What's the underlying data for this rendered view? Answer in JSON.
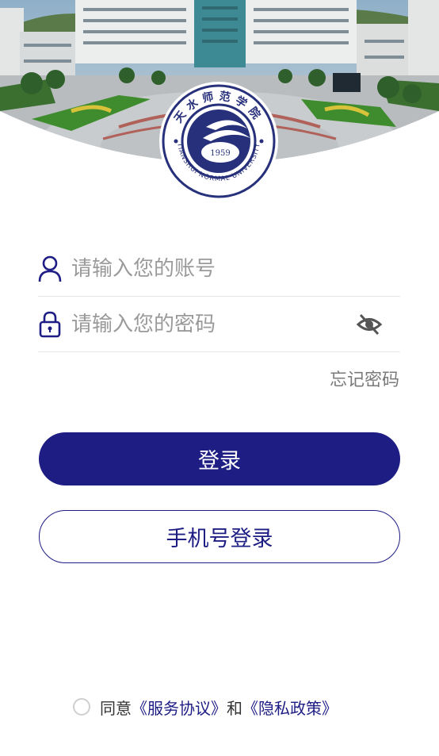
{
  "header": {
    "emblem": {
      "name_cn": "天水师范学院",
      "name_en": "TIANSHUI NORMAL UNIVERSITY",
      "year": "1959"
    }
  },
  "form": {
    "account_placeholder": "请输入您的账号",
    "password_placeholder": "请输入您的密码",
    "forgot_label": "忘记密码",
    "icons": {
      "account": "user-icon",
      "password": "lock-icon",
      "toggle": "eye-off-icon"
    }
  },
  "actions": {
    "login_label": "登录",
    "phone_login_label": "手机号登录"
  },
  "agreement": {
    "prefix": "同意",
    "service_link": "《服务协议》",
    "conjunction": "和",
    "privacy_link": "《隐私政策》",
    "checked": false
  },
  "colors": {
    "brand": "#1e1d84",
    "placeholder": "#9a9a9a",
    "divider": "#e6e6e6"
  }
}
